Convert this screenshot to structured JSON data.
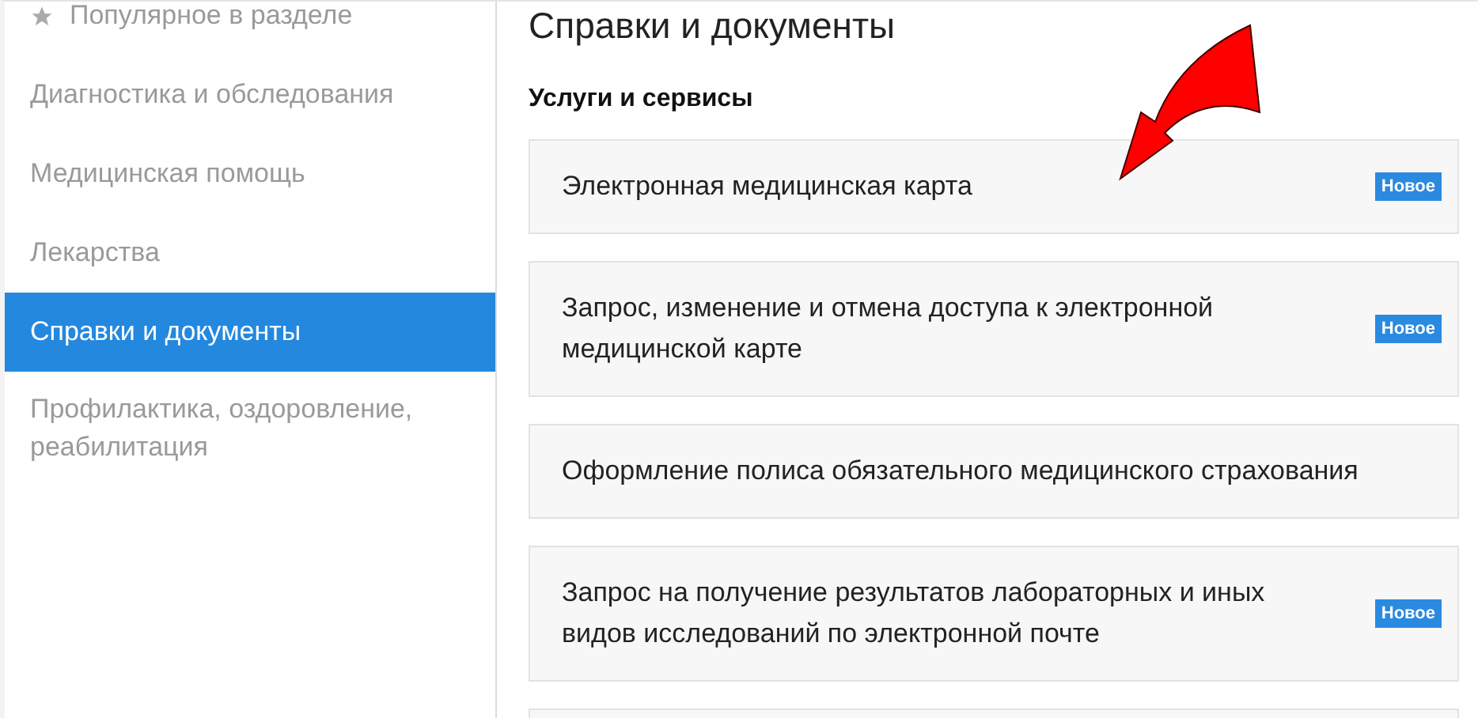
{
  "sidebar": {
    "items": [
      {
        "label": "Популярное в разделе",
        "kind": "popular",
        "selected": false
      },
      {
        "label": "Диагностика и обследования",
        "kind": "link",
        "selected": false
      },
      {
        "label": "Медицинская помощь",
        "kind": "link",
        "selected": false
      },
      {
        "label": "Лекарства",
        "kind": "link",
        "selected": false
      },
      {
        "label": "Справки и документы",
        "kind": "link",
        "selected": true
      },
      {
        "label": "Профилактика, оздоровление, реабилитация",
        "kind": "link",
        "selected": false
      }
    ]
  },
  "main": {
    "title": "Справки и документы",
    "section_heading": "Услуги и сервисы",
    "services": [
      {
        "kind": "service",
        "title": "Электронная медицинская карта",
        "badge": "Новое"
      },
      {
        "kind": "service",
        "title": "Запрос, изменение и отмена доступа к электронной медицинской карте",
        "badge": "Новое"
      },
      {
        "kind": "service",
        "title": "Оформление полиса обязательного медицинского страхования"
      },
      {
        "kind": "service",
        "title": "Запрос на получение результатов лабораторных и иных видов исследований по электронной почте",
        "badge": "Новое"
      },
      {
        "kind": "cut"
      }
    ]
  }
}
